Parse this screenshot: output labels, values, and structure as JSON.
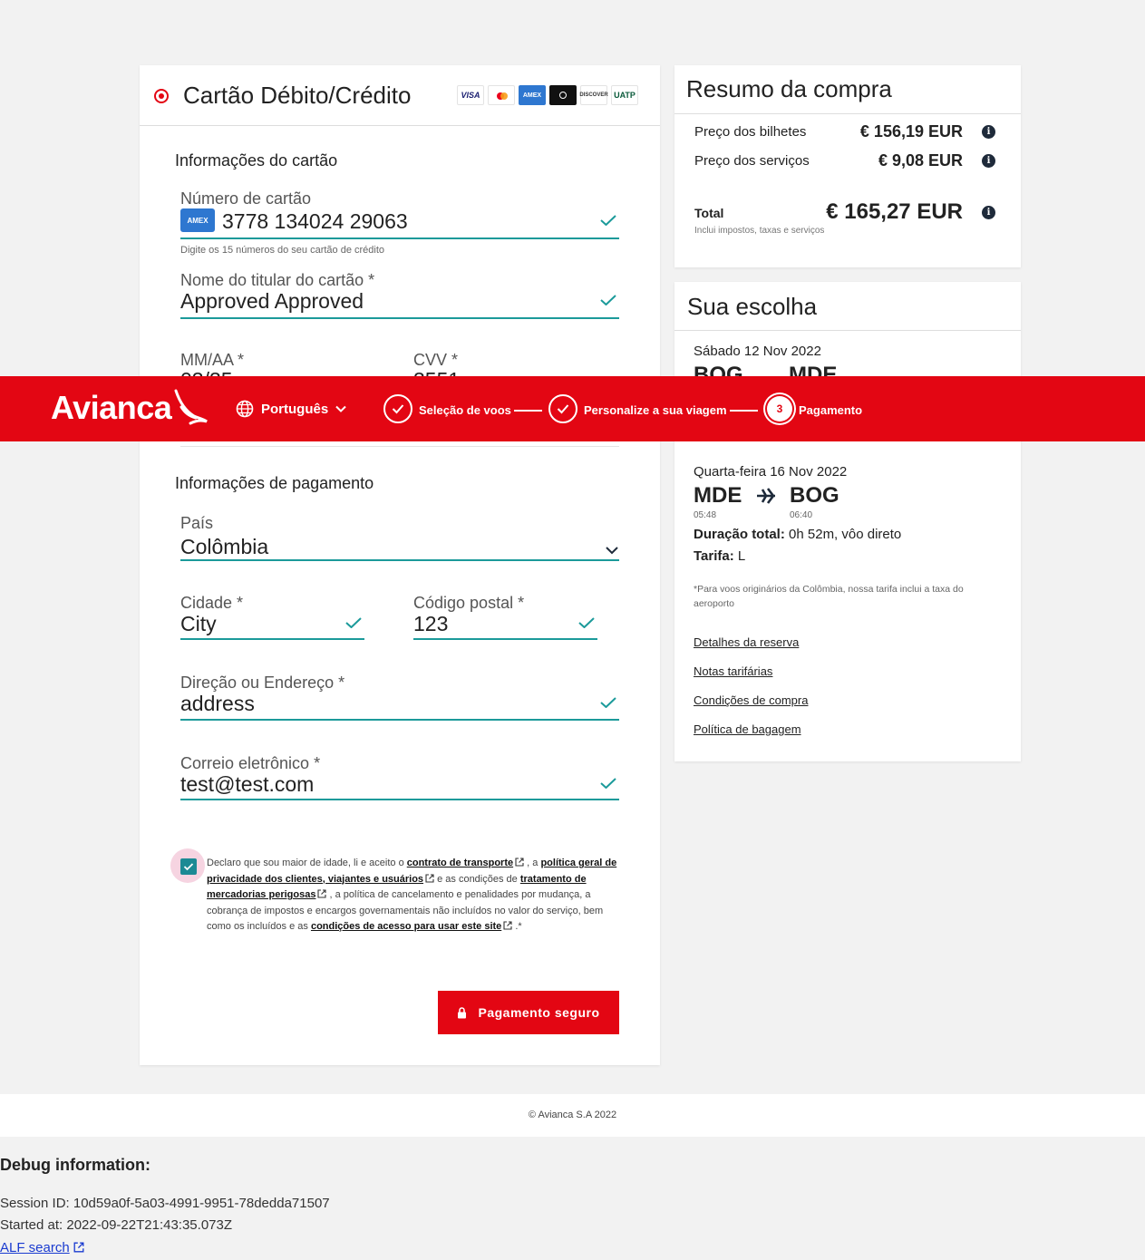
{
  "header": {
    "logo": "Avianca",
    "language": "Português",
    "steps": [
      {
        "label": "Seleção de voos",
        "state": "done"
      },
      {
        "label": "Personalize a sua viagem",
        "state": "done"
      },
      {
        "number": "3",
        "label": "Pagamento",
        "state": "current"
      }
    ]
  },
  "payment": {
    "method_title": "Cartão Débito/Crédito",
    "brands": [
      "VISA",
      "Mastercard",
      "AMEX",
      "Diners",
      "DISCOVER",
      "UATP"
    ],
    "card_info": {
      "title": "Informações do cartão",
      "number_label": "Número de cartão",
      "number_brand_badge": "AMEX",
      "number_value": "3778 134024 29063",
      "number_hint": "Digite os 15 números do seu cartão de crédito",
      "holder_label": "Nome do titular do cartão *",
      "holder_value": "Approved Approved",
      "expiry_label": "MM/AA *",
      "expiry_value": "03/35",
      "cvv_label": "CVV *",
      "cvv_value": "3551"
    },
    "billing": {
      "title": "Informações de pagamento",
      "country_label": "País",
      "country_value": "Colômbia",
      "city_label": "Cidade *",
      "city_value": "City",
      "postal_label": "Código postal *",
      "postal_value": "123",
      "address_label": "Direção ou Endereço *",
      "address_value": "address",
      "email_label": "Correio eletrônico *",
      "email_value": "test@test.com"
    },
    "consent": {
      "checked": true,
      "t1": "Declaro que sou maior de idade, li e aceito o ",
      "link1": "contrato de transporte",
      "t2": " , a ",
      "link2": "política geral de privacidade dos clientes, viajantes e usuários",
      "t3": "  e as condições de ",
      "link3": "tratamento de mercadorias perigosas",
      "t4": " , a política de cancelamento e penalidades por mudança, a cobrança de impostos e encargos governamentais não incluídos no valor do serviço, bem como os incluídos e as ",
      "link4": "condições de acesso para usar este site",
      "t5": " .*"
    },
    "submit_label": "Pagamento seguro"
  },
  "summary": {
    "title": "Resumo da compra",
    "tickets_label": "Preço dos bilhetes",
    "tickets_value": "€ 156,19 EUR",
    "services_label": "Preço dos serviços",
    "services_value": "€ 9,08 EUR",
    "total_label": "Total",
    "total_value": "€ 165,27 EUR",
    "total_note": "Inclui impostos, taxas e serviços"
  },
  "choice": {
    "title": "Sua escolha",
    "outbound": {
      "date": "Sábado 12 Nov 2022",
      "from": "BOG",
      "to": "MDE"
    },
    "return": {
      "date": "Quarta-feira 16 Nov 2022",
      "from": "MDE",
      "to": "BOG",
      "dep_time": "05:48",
      "arr_time": "06:40",
      "duration_label": "Duração total:",
      "duration_value": " 0h 52m,  vôo direto",
      "fare_label": "Tarifa:",
      "fare_value": " L"
    },
    "note": "*Para voos originários da Colômbia, nossa tarifa inclui a taxa do aeroporto",
    "links": [
      "Detalhes da reserva",
      "Notas tarifárias",
      "Condições de compra",
      "Política de bagagem"
    ]
  },
  "footer": {
    "copyright": "© Avianca S.A 2022"
  },
  "debug": {
    "title": "Debug information:",
    "session": "Session ID: 10d59a0f-5a03-4991-9951-78dedda71507",
    "started": "Started at: 2022-09-22T21:43:35.073Z",
    "link": "ALF search"
  },
  "colors": {
    "brand_red": "#e30613",
    "field_accent": "#1b9a9a",
    "checkbox": "#1b8a94"
  }
}
